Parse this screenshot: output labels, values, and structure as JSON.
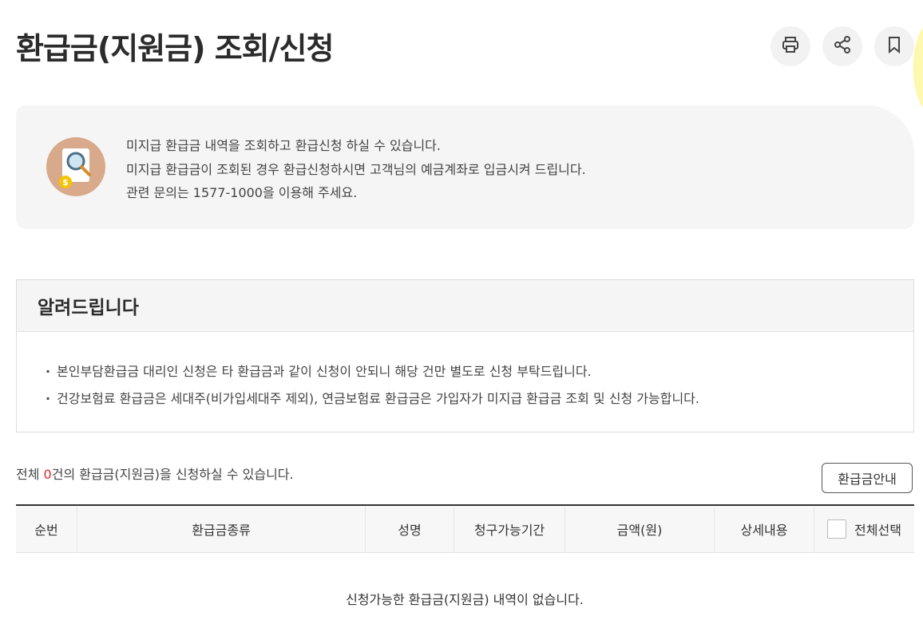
{
  "page": {
    "title": "환급금(지원금) 조회/신청"
  },
  "toolbar": {
    "print_icon": "print-icon",
    "share_icon": "share-icon",
    "bookmark_icon": "bookmark-icon"
  },
  "info": {
    "icon": "magnifier-document-icon",
    "lines": [
      "미지급 환급금 내역을 조회하고 환급신청 하실 수 있습니다.",
      "미지급 환급금이 조회된 경우 환급신청하시면 고객님의 예금계좌로 입금시켜 드립니다.",
      "관련 문의는 1577-1000을 이용해 주세요."
    ]
  },
  "notice": {
    "title": "알려드립니다",
    "items": [
      "본인부담환급금 대리인 신청은 타 환급금과 같이 신청이 안되니 해당 건만 별도로 신청 부탁드립니다.",
      "건강보험료 환급금은 세대주(비가입세대주 제외), 연금보험료 환급금은 가입자가 미지급 환급금 조회 및 신청 가능합니다."
    ]
  },
  "summary": {
    "prefix": "전체 ",
    "count": "0",
    "suffix": "건의 환급금(지원금)을 신청하실 수 있습니다."
  },
  "guide_button": "환급금안내",
  "table": {
    "columns": [
      "순번",
      "환급금종류",
      "성명",
      "청구가능기간",
      "금액(원)",
      "상세내용",
      "전체선택"
    ],
    "empty_message": "신청가능한 환급금(지원금) 내역이 없습니다."
  },
  "colors": {
    "accent_count": "#e0282e",
    "info_bg": "#f5f5f5"
  }
}
